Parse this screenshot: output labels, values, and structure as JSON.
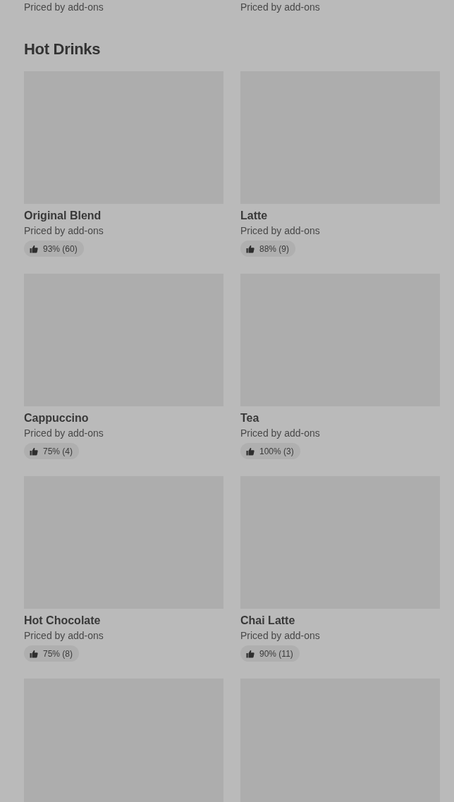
{
  "previous_section": {
    "items": [
      {
        "subtitle": "Priced by add-ons"
      },
      {
        "subtitle": "Priced by add-ons"
      }
    ]
  },
  "section": {
    "title": "Hot Drinks",
    "items": [
      {
        "kind": "product",
        "title": "Original Blend",
        "subtitle": "Priced by add-ons",
        "rating": "93% (60)"
      },
      {
        "kind": "product",
        "title": "Latte",
        "subtitle": "Priced by add-ons",
        "rating": "88% (9)"
      },
      {
        "kind": "product",
        "title": "Cappuccino",
        "subtitle": "Priced by add-ons",
        "rating": "75% (4)"
      },
      {
        "kind": "product",
        "title": "Tea",
        "subtitle": "Priced by add-ons",
        "rating": "100% (3)"
      },
      {
        "kind": "product",
        "title": "Hot Chocolate",
        "subtitle": "Priced by add-ons",
        "rating": "75% (8)"
      },
      {
        "kind": "product",
        "title": "Chai Latte",
        "subtitle": "Priced by add-ons",
        "rating": "90% (11)"
      },
      {
        "kind": "picture"
      },
      {
        "kind": "picture"
      }
    ]
  }
}
